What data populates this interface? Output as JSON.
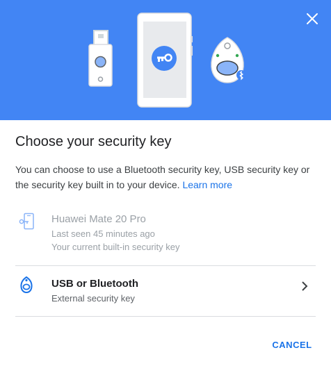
{
  "dialog": {
    "title": "Choose your security key",
    "description": "You can choose to use a Bluetooth security key, USB security key or the security key built in to your device.",
    "learn_more": "Learn more",
    "close_icon": "close-icon"
  },
  "options": [
    {
      "title": "Huawei Mate 20 Pro",
      "line1": "Last seen 45 minutes ago",
      "line2": "Your current built-in security key",
      "icon": "phone-key-icon",
      "state": "disabled"
    },
    {
      "title": "USB or Bluetooth",
      "line1": "External security key",
      "icon": "security-key-icon",
      "state": "enabled"
    }
  ],
  "actions": {
    "cancel_label": "CANCEL"
  },
  "colors": {
    "banner": "#4285f4",
    "accent": "#1a73e8",
    "divider": "#dadce0"
  }
}
